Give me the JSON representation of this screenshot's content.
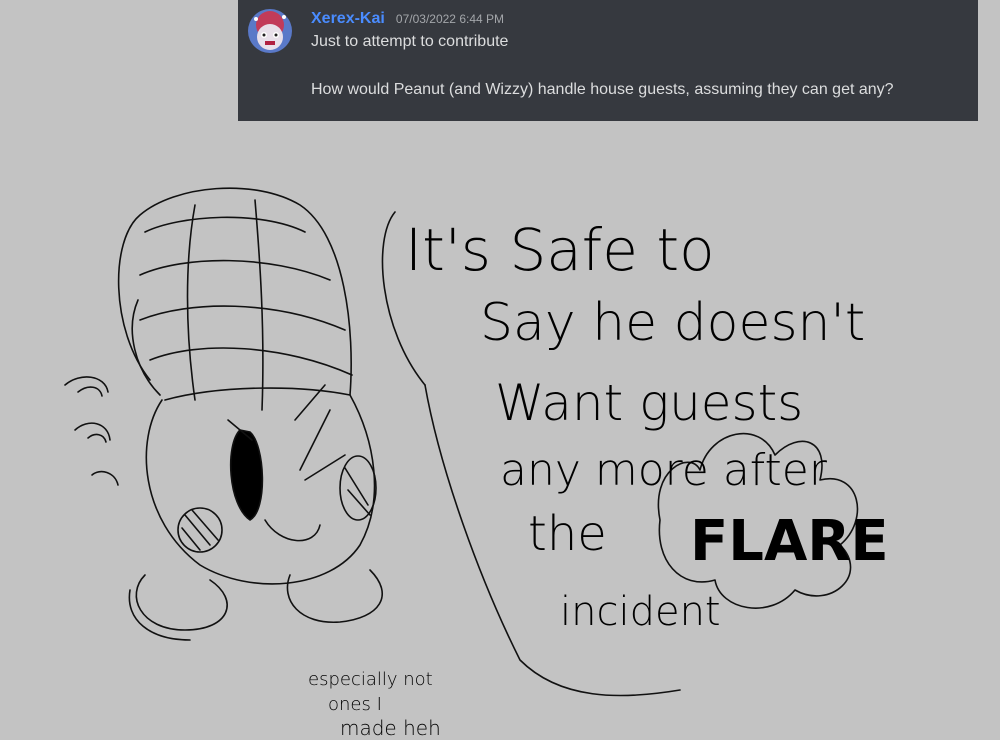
{
  "message": {
    "username": "Xerex-Kai",
    "timestamp": "07/03/2022 6:44 PM",
    "line1": "Just to attempt to contribute",
    "line2": "How would Peanut (and Wizzy) handle house guests, assuming they can get any?",
    "colors": {
      "background": "#36393f",
      "username": "#4a8cff",
      "text": "#dcddde",
      "timestamp": "#a3a6aa"
    }
  },
  "drawing": {
    "speech_lines": [
      "It's Safe to",
      "Say he doesn't",
      "Want guests",
      "any more after",
      "the",
      "incident"
    ],
    "flare_word": "FLARE",
    "side_note": [
      "especially not",
      "ones I",
      "made heh"
    ],
    "canvas_color": "#c3c3c3"
  }
}
